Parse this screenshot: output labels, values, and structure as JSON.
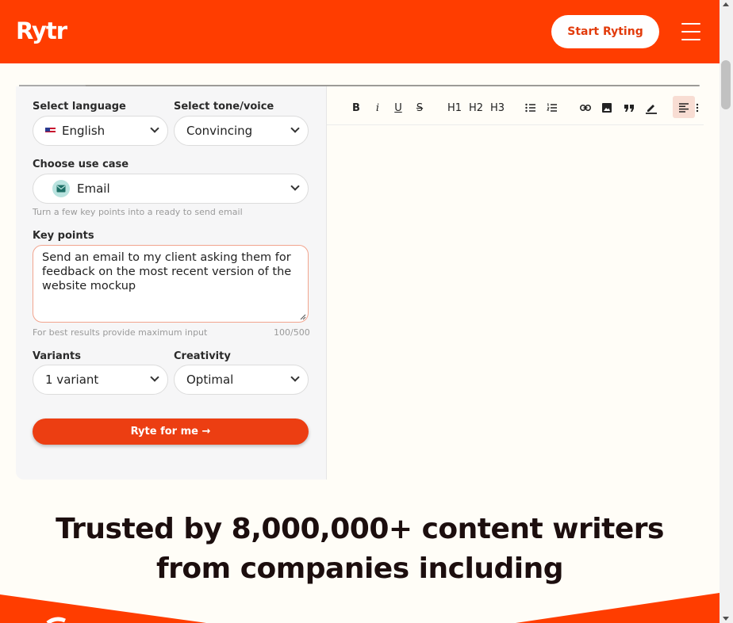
{
  "header": {
    "logo_text": "Rytr",
    "cta_label": "Start Ryting",
    "menu_icon": "hamburger-menu-icon",
    "brand_color": "#ff3d00"
  },
  "editor": {
    "language": {
      "label": "Select language",
      "value": "English"
    },
    "tone": {
      "label": "Select tone/voice",
      "value": "Convincing"
    },
    "use_case": {
      "label": "Choose use case",
      "value": "Email",
      "hint": "Turn a few key points into a ready to send email"
    },
    "key_points": {
      "label": "Key points",
      "value": "Send an email to my client asking them for feedback on the most recent version of the website mockup",
      "hint": "For best results provide maximum input",
      "counter": "100/500"
    },
    "variants": {
      "label": "Variants",
      "value": "1 variant"
    },
    "creativity": {
      "label": "Creativity",
      "value": "Optimal"
    },
    "submit_label": "Ryte for me →"
  },
  "toolbar": {
    "bold": "B",
    "italic": "i",
    "underline": "U",
    "strike": "S",
    "h1": "H1",
    "h2": "H2",
    "h3": "H3",
    "icons": [
      "bulleted-list-icon",
      "numbered-list-icon",
      "link-icon",
      "image-icon",
      "quote-icon",
      "highlight-pen-icon",
      "align-left-icon",
      "more-icon"
    ]
  },
  "trusted": {
    "line1": "Trusted by 8,000,000+ content writers",
    "line2": "from companies including"
  }
}
